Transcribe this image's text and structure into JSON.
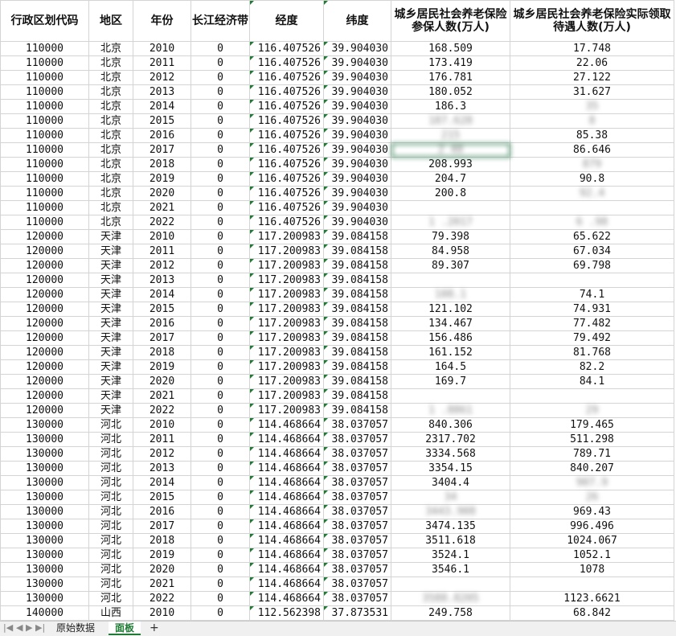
{
  "headers": [
    "行政区划代码",
    "地区",
    "年份",
    "长江经济带",
    "经度",
    "纬度",
    "城乡居民社会养老保险参保人数(万人)",
    "城乡居民社会养老保险实际领取待遇人数(万人)"
  ],
  "rows": [
    [
      "110000",
      "北京",
      "2010",
      "0",
      "116.407526",
      "39.904030",
      "168.509",
      "17.748"
    ],
    [
      "110000",
      "北京",
      "2011",
      "0",
      "116.407526",
      "39.904030",
      "173.419",
      "22.06"
    ],
    [
      "110000",
      "北京",
      "2012",
      "0",
      "116.407526",
      "39.904030",
      "176.781",
      "27.122"
    ],
    [
      "110000",
      "北京",
      "2013",
      "0",
      "116.407526",
      "39.904030",
      "180.052",
      "31.627"
    ],
    [
      "110000",
      "北京",
      "2014",
      "0",
      "116.407526",
      "39.904030",
      "186.3",
      "35"
    ],
    [
      "110000",
      "北京",
      "2015",
      "0",
      "116.407526",
      "39.904030",
      "187.628",
      "8"
    ],
    [
      "110000",
      "北京",
      "2016",
      "0",
      "116.407526",
      "39.904030",
      "215",
      "85.38"
    ],
    [
      "110000",
      "北京",
      "2017",
      "0",
      "116.407526",
      "39.904030",
      "2  40",
      "86.646"
    ],
    [
      "110000",
      "北京",
      "2018",
      "0",
      "116.407526",
      "39.904030",
      "208.993",
      "879"
    ],
    [
      "110000",
      "北京",
      "2019",
      "0",
      "116.407526",
      "39.904030",
      "204.7",
      "90.8"
    ],
    [
      "110000",
      "北京",
      "2020",
      "0",
      "116.407526",
      "39.904030",
      "200.8",
      "92.4"
    ],
    [
      "110000",
      "北京",
      "2021",
      "0",
      "116.407526",
      "39.904030",
      "",
      ""
    ],
    [
      "110000",
      "北京",
      "2022",
      "0",
      "116.407526",
      "39.904030",
      "1  .2017",
      "6  .98"
    ],
    [
      "120000",
      "天津",
      "2010",
      "0",
      "117.200983",
      "39.084158",
      "79.398",
      "65.622"
    ],
    [
      "120000",
      "天津",
      "2011",
      "0",
      "117.200983",
      "39.084158",
      "84.958",
      "67.034"
    ],
    [
      "120000",
      "天津",
      "2012",
      "0",
      "117.200983",
      "39.084158",
      "89.307",
      "69.798"
    ],
    [
      "120000",
      "天津",
      "2013",
      "0",
      "117.200983",
      "39.084158",
      "",
      ""
    ],
    [
      "120000",
      "天津",
      "2014",
      "0",
      "117.200983",
      "39.084158",
      "108.1",
      "74.1"
    ],
    [
      "120000",
      "天津",
      "2015",
      "0",
      "117.200983",
      "39.084158",
      "121.102",
      "74.931"
    ],
    [
      "120000",
      "天津",
      "2016",
      "0",
      "117.200983",
      "39.084158",
      "134.467",
      "77.482"
    ],
    [
      "120000",
      "天津",
      "2017",
      "0",
      "117.200983",
      "39.084158",
      "156.486",
      "79.492"
    ],
    [
      "120000",
      "天津",
      "2018",
      "0",
      "117.200983",
      "39.084158",
      "161.152",
      "81.768"
    ],
    [
      "120000",
      "天津",
      "2019",
      "0",
      "117.200983",
      "39.084158",
      "164.5",
      "82.2"
    ],
    [
      "120000",
      "天津",
      "2020",
      "0",
      "117.200983",
      "39.084158",
      "169.7",
      "84.1"
    ],
    [
      "120000",
      "天津",
      "2021",
      "0",
      "117.200983",
      "39.084158",
      "",
      ""
    ],
    [
      "120000",
      "天津",
      "2022",
      "0",
      "117.200983",
      "39.084158",
      "1  .8861",
      "29"
    ],
    [
      "130000",
      "河北",
      "2010",
      "0",
      "114.468664",
      "38.037057",
      "840.306",
      "179.465"
    ],
    [
      "130000",
      "河北",
      "2011",
      "0",
      "114.468664",
      "38.037057",
      "2317.702",
      "511.298"
    ],
    [
      "130000",
      "河北",
      "2012",
      "0",
      "114.468664",
      "38.037057",
      "3334.568",
      "789.71"
    ],
    [
      "130000",
      "河北",
      "2013",
      "0",
      "114.468664",
      "38.037057",
      "3354.15",
      "840.207"
    ],
    [
      "130000",
      "河北",
      "2014",
      "0",
      "114.468664",
      "38.037057",
      "3404.4",
      "907.9"
    ],
    [
      "130000",
      "河北",
      "2015",
      "0",
      "114.468664",
      "38.037057",
      "34",
      "26"
    ],
    [
      "130000",
      "河北",
      "2016",
      "0",
      "114.468664",
      "38.037057",
      "3443.908",
      "969.43"
    ],
    [
      "130000",
      "河北",
      "2017",
      "0",
      "114.468664",
      "38.037057",
      "3474.135",
      "996.496"
    ],
    [
      "130000",
      "河北",
      "2018",
      "0",
      "114.468664",
      "38.037057",
      "3511.618",
      "1024.067"
    ],
    [
      "130000",
      "河北",
      "2019",
      "0",
      "114.468664",
      "38.037057",
      "3524.1",
      "1052.1"
    ],
    [
      "130000",
      "河北",
      "2020",
      "0",
      "114.468664",
      "38.037057",
      "3546.1",
      "1078"
    ],
    [
      "130000",
      "河北",
      "2021",
      "0",
      "114.468664",
      "38.037057",
      "",
      ""
    ],
    [
      "130000",
      "河北",
      "2022",
      "0",
      "114.468664",
      "38.037057",
      "3588.8205",
      "1123.6621"
    ],
    [
      "140000",
      "山西",
      "2010",
      "0",
      "112.562398",
      "37.873531",
      "249.758",
      "68.842"
    ]
  ],
  "blurred_cells": [
    [
      4,
      7
    ],
    [
      5,
      6
    ],
    [
      5,
      7
    ],
    [
      6,
      6
    ],
    [
      7,
      6
    ],
    [
      8,
      7
    ],
    [
      10,
      7
    ],
    [
      11,
      6
    ],
    [
      11,
      7
    ],
    [
      12,
      6
    ],
    [
      12,
      7
    ],
    [
      16,
      6
    ],
    [
      16,
      7
    ],
    [
      17,
      6
    ],
    [
      24,
      6
    ],
    [
      24,
      7
    ],
    [
      25,
      6
    ],
    [
      25,
      7
    ],
    [
      30,
      7
    ],
    [
      31,
      6
    ],
    [
      31,
      7
    ],
    [
      32,
      6
    ],
    [
      37,
      6
    ],
    [
      37,
      7
    ],
    [
      38,
      6
    ]
  ],
  "selected_cell": [
    7,
    6
  ],
  "tabs": [
    "原始数据",
    "面板"
  ],
  "active_tab": "面板",
  "add_tab_label": "+",
  "nav_glyphs": [
    "|◀",
    "◀",
    "▶",
    "▶|"
  ]
}
